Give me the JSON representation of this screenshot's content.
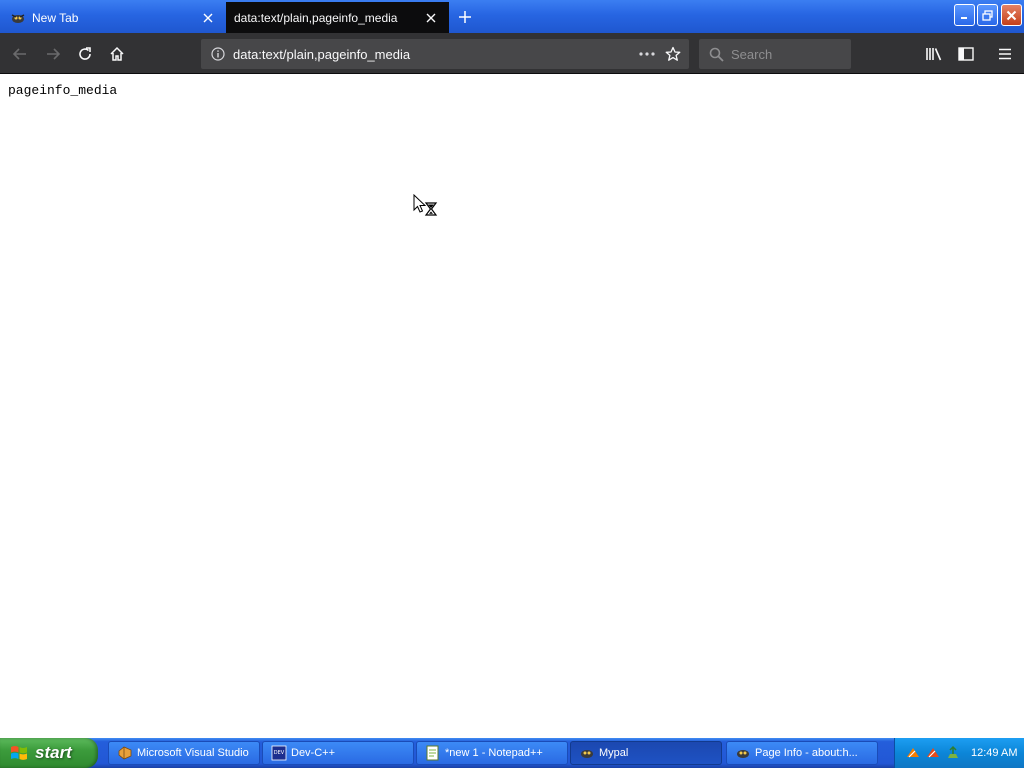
{
  "browser": {
    "tabs": [
      {
        "label": "New Tab",
        "active": false
      },
      {
        "label": "data:text/plain,pageinfo_media",
        "active": true
      }
    ],
    "url": "data:text/plain,pageinfo_media",
    "search_placeholder": "Search"
  },
  "page": {
    "text": "pageinfo_media"
  },
  "taskbar": {
    "start_label": "start",
    "tasks": [
      {
        "label": "Microsoft Visual Studio",
        "icon": "visual-studio-icon"
      },
      {
        "label": "Dev-C++",
        "icon": "devcpp-icon"
      },
      {
        "label": "*new 1 - Notepad++",
        "icon": "notepadpp-icon"
      },
      {
        "label": "Mypal",
        "icon": "mypal-icon",
        "active": true
      },
      {
        "label": "Page Info - about:h...",
        "icon": "mypal-icon"
      }
    ],
    "clock": "12:49 AM"
  },
  "colors": {
    "titlebar": "#2765e2",
    "toolbar": "#323234",
    "urlbar": "#474749",
    "taskbar": "#245edb",
    "start": "#3c9c3c",
    "tray": "#0c86d8"
  }
}
